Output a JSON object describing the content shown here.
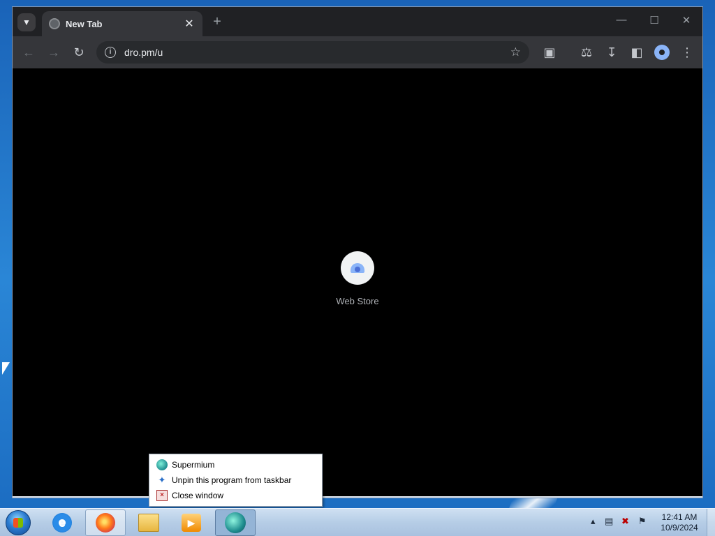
{
  "browser": {
    "tab": {
      "title": "New Tab"
    },
    "new_tab_glyph": "+",
    "address": {
      "url": "dro.pm/u"
    },
    "icons": [
      "back-icon",
      "forward-icon",
      "reload-icon",
      "info-icon",
      "bookmark-star-icon",
      "extensions-icon",
      "labs-icon",
      "downloads-icon",
      "side-panel-icon",
      "profile-icon",
      "menu-icon"
    ]
  },
  "content": {
    "shortcut": {
      "label": "Web Store",
      "icon": "web-store-icon"
    }
  },
  "context_menu": {
    "items": [
      {
        "label": "Supermium",
        "icon": "supermium-icon"
      },
      {
        "label": "Unpin this program from taskbar",
        "icon": "unpin-icon"
      },
      {
        "label": "Close window",
        "icon": "close-window-icon"
      }
    ]
  },
  "taskbar": {
    "apps": [
      "internet-explorer-icon",
      "firefox-icon",
      "file-explorer-icon",
      "media-player-icon",
      "supermium-icon"
    ],
    "clock": {
      "time": "12:41 AM",
      "date": "10/9/2024"
    }
  },
  "colors": {
    "tabstrip": "#202124",
    "toolbar": "#35363a",
    "content_bg": "#000000",
    "taskbar": "#b6cde6"
  }
}
